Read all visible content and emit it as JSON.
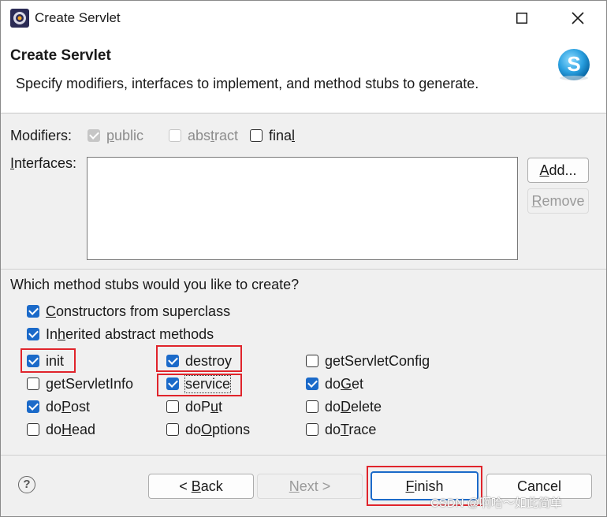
{
  "window": {
    "title": "Create Servlet",
    "maximize_icon": "maximize-icon",
    "close_icon": "close-icon"
  },
  "banner": {
    "title": "Create Servlet",
    "description": "Specify modifiers, interfaces to implement, and method stubs to generate.",
    "logo_icon": "servlet-s-logo"
  },
  "modifiers": {
    "label": "Modifiers:",
    "public": {
      "pre": "",
      "u": "p",
      "post": "ublic",
      "checked": true,
      "enabled": false
    },
    "abstract": {
      "pre": "abs",
      "u": "t",
      "post": "ract",
      "checked": false,
      "enabled": false
    },
    "final": {
      "pre": "fina",
      "u": "l",
      "post": "",
      "checked": false,
      "enabled": true
    }
  },
  "interfaces": {
    "label_pre": "",
    "label_u": "I",
    "label_post": "nterfaces:",
    "add_pre": "",
    "add_u": "A",
    "add_post": "dd...",
    "remove_pre": "",
    "remove_u": "R",
    "remove_post": "emove"
  },
  "stubs": {
    "question": "Which method stubs would you like to create?",
    "constructors": {
      "pre": "",
      "u": "C",
      "post": "onstructors from superclass",
      "checked": true
    },
    "inherited": {
      "pre": "In",
      "u": "h",
      "post": "erited abstract methods",
      "checked": true
    },
    "init": {
      "pre": "init",
      "u": "",
      "post": "",
      "checked": true
    },
    "destroy": {
      "pre": "destroy",
      "u": "",
      "post": "",
      "checked": true
    },
    "getServletConfig": {
      "pre": "getServletConfig",
      "u": "",
      "post": "",
      "checked": false
    },
    "getServletInfo": {
      "pre": "getServletInfo",
      "u": "",
      "post": "",
      "checked": false
    },
    "service": {
      "pre": "service",
      "u": "",
      "post": "",
      "checked": true
    },
    "doGet": {
      "pre": "do",
      "u": "G",
      "post": "et",
      "checked": true
    },
    "doPost": {
      "pre": "do",
      "u": "P",
      "post": "ost",
      "checked": true
    },
    "doPut": {
      "pre": "doP",
      "u": "u",
      "post": "t",
      "checked": false
    },
    "doDelete": {
      "pre": "do",
      "u": "D",
      "post": "elete",
      "checked": false
    },
    "doHead": {
      "pre": "do",
      "u": "H",
      "post": "ead",
      "checked": false
    },
    "doOptions": {
      "pre": "do",
      "u": "O",
      "post": "ptions",
      "checked": false
    },
    "doTrace": {
      "pre": "do",
      "u": "T",
      "post": "race",
      "checked": false
    }
  },
  "footer": {
    "help_icon": "help-icon",
    "help_glyph": "?",
    "back": {
      "pre": "< ",
      "u": "B",
      "post": "ack"
    },
    "next": {
      "pre": "",
      "u": "N",
      "post": "ext >"
    },
    "finish": {
      "pre": "",
      "u": "F",
      "post": "inish"
    },
    "cancel": "Cancel",
    "watermark": "CSDN @啊哈～如此简单"
  },
  "colors": {
    "check_blue": "#1b6ac9",
    "highlight_red": "#e0242b"
  }
}
